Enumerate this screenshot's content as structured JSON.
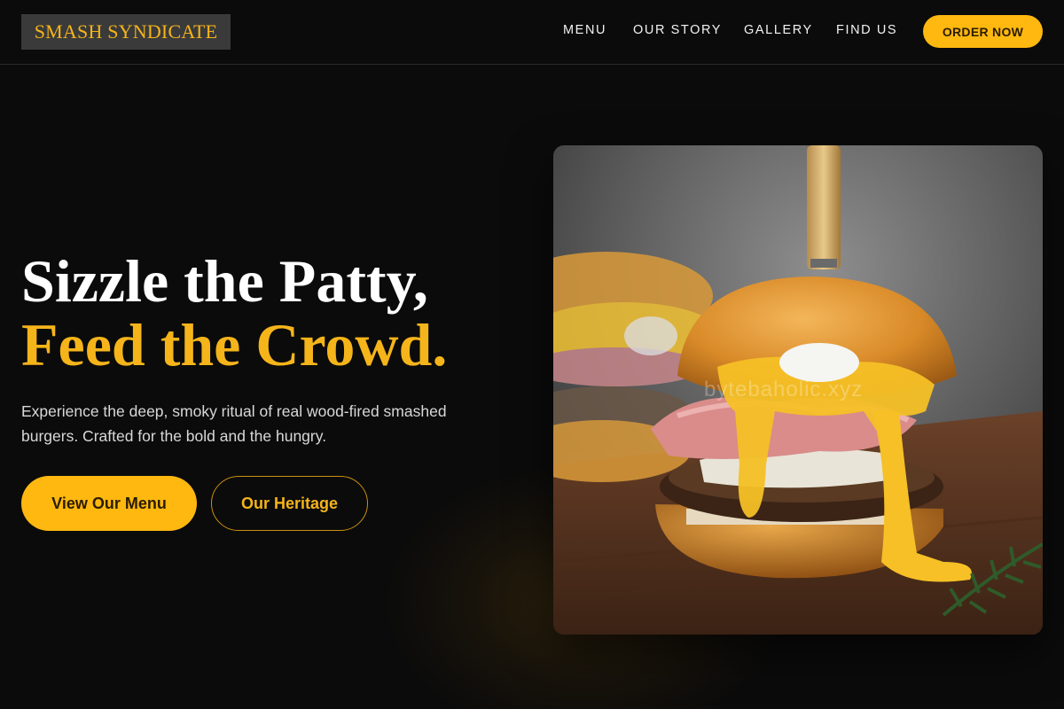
{
  "brand": {
    "name": "SMASH SYNDICATE"
  },
  "nav": {
    "links": [
      "MENU",
      "OUR STORY",
      "GALLERY",
      "FIND US"
    ],
    "cta": "ORDER NOW"
  },
  "hero": {
    "headline_line1": "Sizzle the Patty,",
    "headline_line2": "Feed the Crowd.",
    "description": "Experience the deep, smoky ritual of real wood-fired smashed burgers. Crafted for the bold and the hungry.",
    "primary_button": "View Our Menu",
    "secondary_button": "Our Heritage",
    "image_watermark": "bytebaholic.xyz"
  },
  "colors": {
    "background": "#0b0b0b",
    "accent": "#ffb80f",
    "accent_text": "#f5b41a"
  }
}
